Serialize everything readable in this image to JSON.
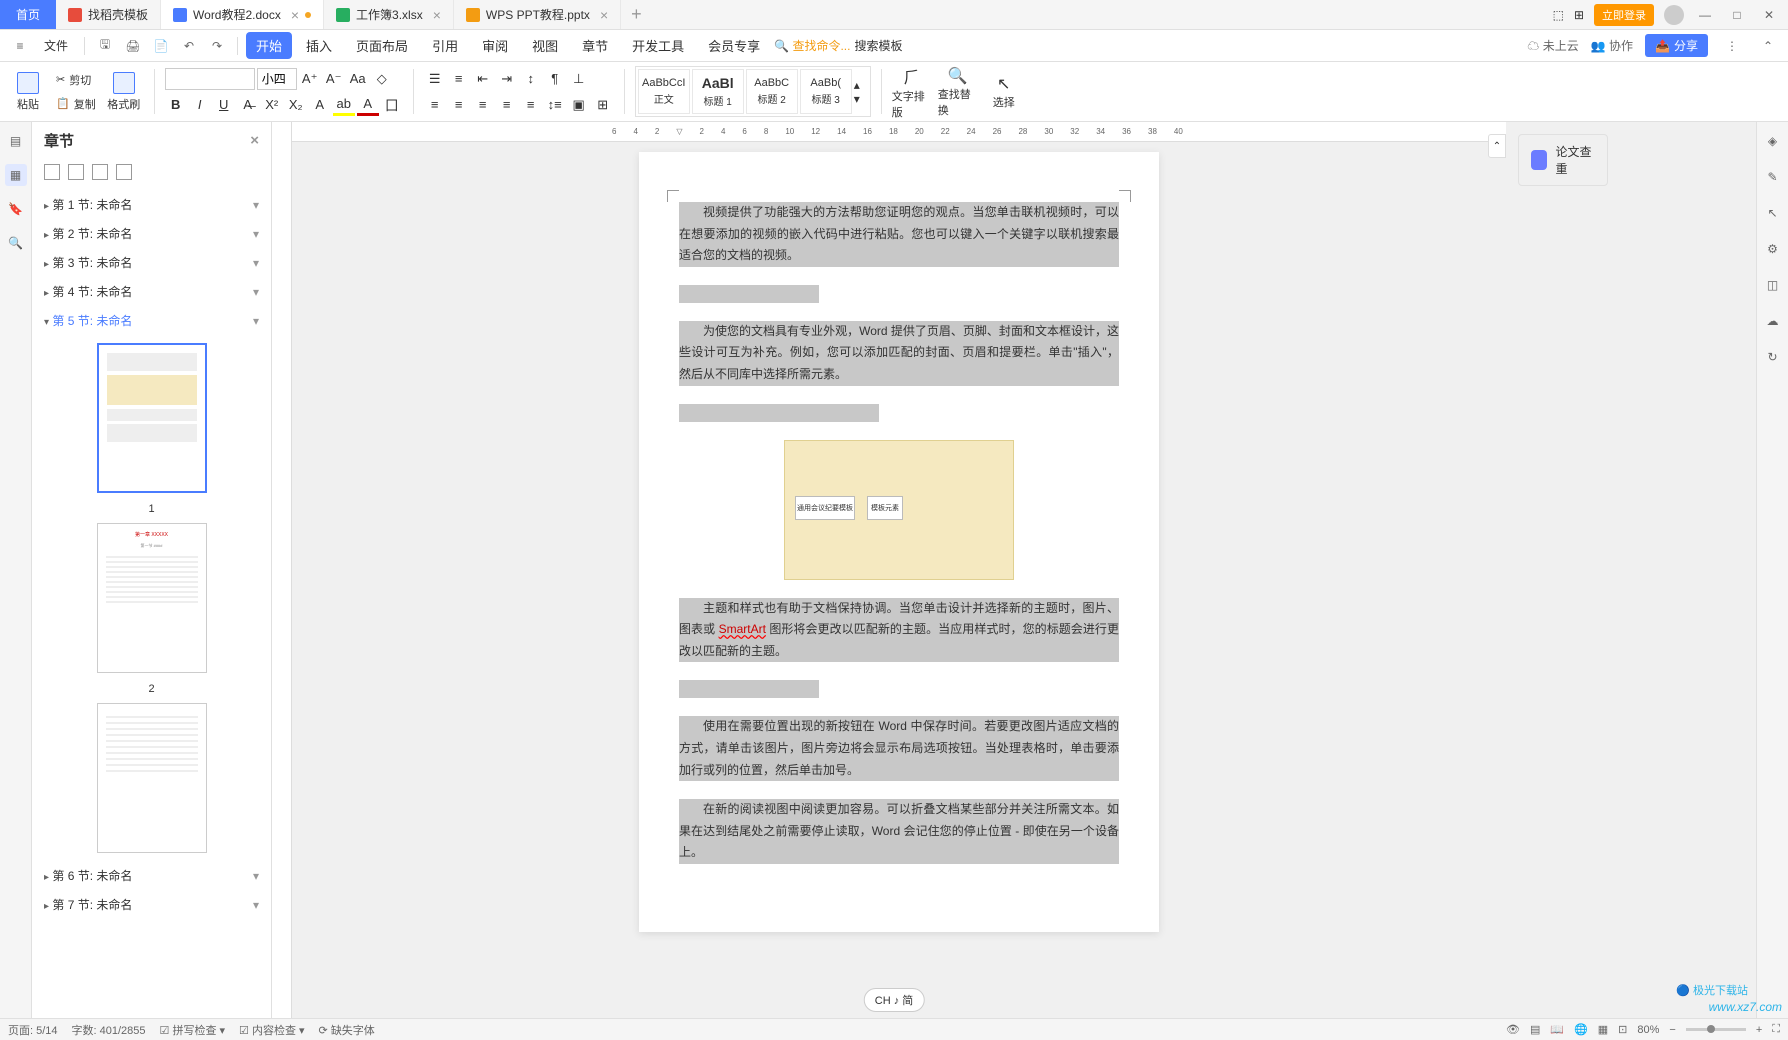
{
  "tabs": {
    "home": "首页",
    "items": [
      {
        "icon": "red",
        "label": "找稻壳模板"
      },
      {
        "icon": "blue",
        "label": "Word教程2.docx",
        "active": true,
        "modified": true
      },
      {
        "icon": "green",
        "label": "工作簿3.xlsx"
      },
      {
        "icon": "orange",
        "label": "WPS PPT教程.pptx"
      }
    ]
  },
  "top_right": {
    "login": "立即登录"
  },
  "menu": {
    "file": "文件",
    "items": [
      "开始",
      "插入",
      "页面布局",
      "引用",
      "审阅",
      "视图",
      "章节",
      "开发工具",
      "会员专享"
    ],
    "search_cmd": "查找命令...",
    "search_tpl": "搜索模板",
    "cloud": "未上云",
    "coop": "协作",
    "share": "分享"
  },
  "ribbon": {
    "paste": "粘贴",
    "cut": "剪切",
    "copy": "复制",
    "format_painter": "格式刷",
    "font_name": "",
    "font_size": "小四",
    "styles": [
      {
        "preview": "AaBbCcI",
        "name": "正文"
      },
      {
        "preview": "AaBl",
        "name": "标题 1",
        "big": true
      },
      {
        "preview": "AaBbC",
        "name": "标题 2"
      },
      {
        "preview": "AaBb(",
        "name": "标题 3"
      }
    ],
    "text_layout": "文字排版",
    "find_replace": "查找替换",
    "select": "选择"
  },
  "ruler_marks": [
    "6",
    "4",
    "2",
    "",
    "2",
    "4",
    "6",
    "8",
    "10",
    "12",
    "14",
    "16",
    "18",
    "20",
    "22",
    "24",
    "26",
    "28",
    "30",
    "32",
    "34",
    "36",
    "38",
    "40"
  ],
  "sidebar": {
    "title": "章节",
    "sections": [
      {
        "label": "第 1 节: 未命名"
      },
      {
        "label": "第 2 节: 未命名"
      },
      {
        "label": "第 3 节: 未命名"
      },
      {
        "label": "第 4 节: 未命名"
      },
      {
        "label": "第 5 节: 未命名",
        "active": true,
        "expanded": true
      },
      {
        "label": "第 6 节: 未命名"
      },
      {
        "label": "第 7 节: 未命名"
      }
    ],
    "thumbs": [
      "1",
      "2"
    ]
  },
  "document": {
    "para1": "视频提供了功能强大的方法帮助您证明您的观点。当您单击联机视频时，可以在想要添加的视频的嵌入代码中进行粘贴。您也可以键入一个关键字以联机搜索最适合您的文档的视频。",
    "para2": "为使您的文档具有专业外观，Word 提供了页眉、页脚、封面和文本框设计，这些设计可互为补充。例如，您可以添加匹配的封面、页眉和提要栏。单击\"插入\"，然后从不同库中选择所需元素。",
    "para3_a": "主题和样式也有助于文档保持协调。当您单击设计并选择新的主题时，图片、图表或 ",
    "para3_smartart": "SmartArt",
    "para3_b": " 图形将会更改以匹配新的主题。当应用样式时，您的标题会进行更改以匹配新的主题。",
    "para4": "使用在需要位置出现的新按钮在 Word 中保存时间。若要更改图片适应文档的方式，请单击该图片，图片旁边将会显示布局选项按钮。当处理表格时，单击要添加行或列的位置，然后单击加号。",
    "para5": "在新的阅读视图中阅读更加容易。可以折叠文档某些部分并关注所需文本。如果在达到结尾处之前需要停止读取，Word 会记住您的停止位置 - 即使在另一个设备上。"
  },
  "right_panel": {
    "essay_check": "论文查重"
  },
  "status": {
    "page": "页面: 5/14",
    "words": "字数: 401/2855",
    "spell": "拼写检查",
    "content": "内容检查",
    "font_missing": "缺失字体",
    "lang": "CH ♪ 简",
    "zoom": "80%"
  },
  "watermark": {
    "logo": "极光下载站",
    "url": "www.xz7.com"
  }
}
